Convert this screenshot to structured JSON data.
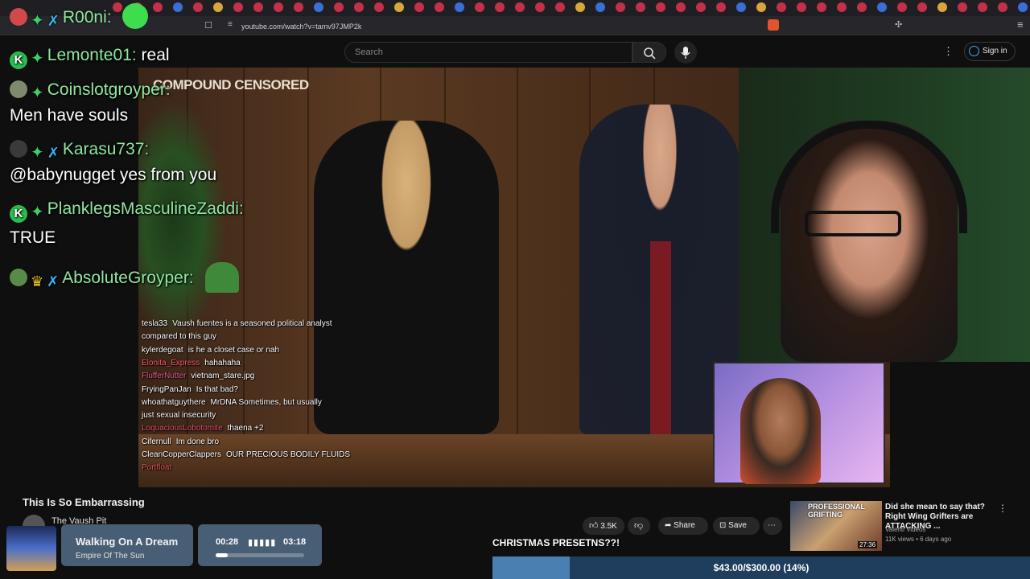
{
  "browser": {
    "url": "youtube.com/watch?v=tamv97JMP2k"
  },
  "youtube": {
    "search_placeholder": "Search",
    "sign_in_label": "Sign in",
    "video_title": "This Is So Embarrassing",
    "channel_name": "The Vaush Pit",
    "likes": "3.5K",
    "share_label": "Share",
    "save_label": "Save",
    "compound_logo": "COMPOUND CENSORED"
  },
  "overlay_top": {
    "username": "R00ni:"
  },
  "big_chat": [
    {
      "user": "Lemonte01:",
      "message": "real",
      "inline": true
    },
    {
      "user": "Coinslotgroyper:",
      "message": "Men have souls",
      "inline": false
    },
    {
      "user": "Karasu737:",
      "message": "@babynugget yes from you",
      "inline": false
    },
    {
      "user": "PlanklegsMasculineZaddi:",
      "message": "TRUE",
      "inline": false
    },
    {
      "user": "AbsoluteGroyper:",
      "message": "",
      "inline": true
    }
  ],
  "small_chat": [
    {
      "user": "tesla33",
      "message": "Vaush fuentes is a seasoned political analyst",
      "color": "#ffffff"
    },
    {
      "user": "",
      "message": "compared to this guy",
      "color": "#ffffff"
    },
    {
      "user": "kylerdegoat",
      "message": "is he a closet case or nah",
      "color": "#ffffff"
    },
    {
      "user": "Elonita_Express",
      "message": "hahahaha",
      "color": "#ff5a6a"
    },
    {
      "user": "FlufferNutter",
      "message": "vietnam_stare.jpg",
      "color": "#e55c8f"
    },
    {
      "user": "FryingPanJan",
      "message": "Is that bad?",
      "color": "#ffffff"
    },
    {
      "user": "whoathatguythere",
      "message": "MrDNA Sometimes, but usually",
      "color": "#ffffff"
    },
    {
      "user": "",
      "message": "just sexual insecurity",
      "color": "#ffffff"
    },
    {
      "user": "LoquaciousLobotomite",
      "message": "thaena +2",
      "color": "#e0556e"
    },
    {
      "user": "Cifernull",
      "message": "Im done bro",
      "color": "#ffffff"
    },
    {
      "user": "CleanCopperClappers",
      "message": "OUR PRECIOUS BODILY FLUIDS",
      "color": "#ffffff"
    },
    {
      "user": "Portfloat",
      "message": "",
      "color": "#e05a5a"
    }
  ],
  "recommendation": {
    "thumb_label": "PROFESSIONAL GRIFTING",
    "duration": "27:36",
    "title": "Did she mean to say that? Right Wing Grifters are ATTACKING ...",
    "channel": "Valenti Videos",
    "meta": "11K views • 6 days ago"
  },
  "music": {
    "track": "Walking On A Dream",
    "artist": "Empire Of The Sun",
    "current_time": "00:28",
    "total_time": "03:18",
    "progress": 0.14
  },
  "donation_goal": {
    "title": "CHRISTMAS PRESETNS??!",
    "text": "$43.00/$300.00 (14%)",
    "fraction": 0.143
  }
}
